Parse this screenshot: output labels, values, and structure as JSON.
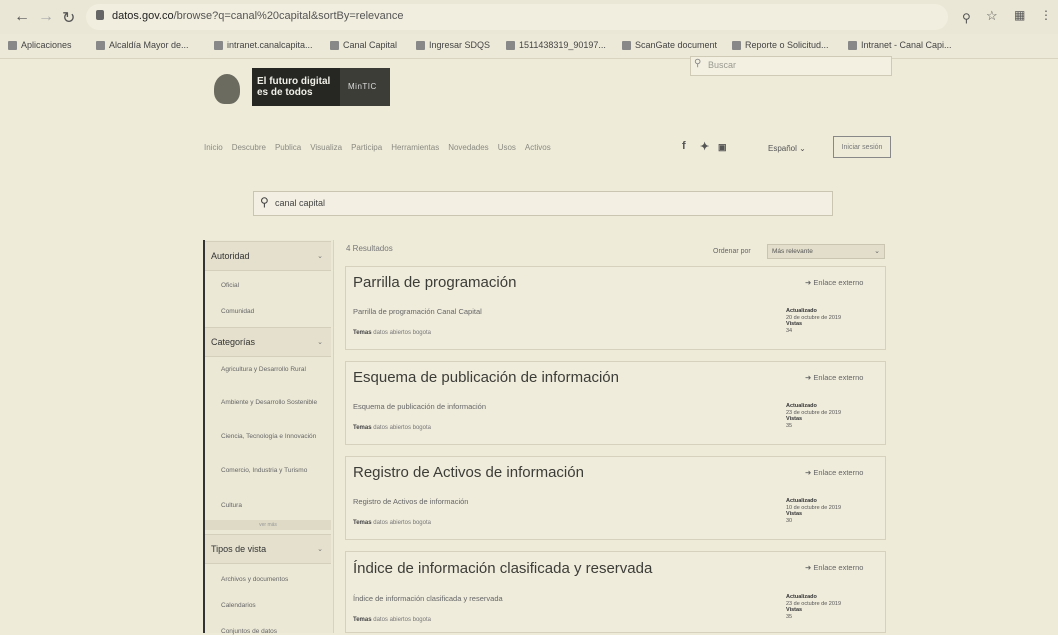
{
  "browser": {
    "url_host": "datos.gov.co",
    "url_path": "/browse?q=canal%20capital&sortBy=relevance",
    "bookmarks": [
      "Aplicaciones",
      "Alcaldía Mayor de...",
      "intranet.canalcapita...",
      "Canal Capital",
      "Ingresar SDQS",
      "1511438319_90197...",
      "ScanGate document",
      "Reporte o Solicitud...",
      "Intranet - Canal Capi..."
    ]
  },
  "header": {
    "logo_line1": "El futuro digital",
    "logo_line2": "es de todos",
    "logo_brand": "MinTIC",
    "search_placeholder": "Buscar",
    "nav": [
      "Inicio",
      "Descubre",
      "Publica",
      "Visualiza",
      "Participa",
      "Herramientas",
      "Novedades",
      "Usos",
      "Activos"
    ],
    "language": "Español",
    "login": "Iniciar sesión"
  },
  "search": {
    "query": "canal capital"
  },
  "sidebar": {
    "sections": [
      {
        "title": "Autoridad",
        "items": [
          "Oficial",
          "Comunidad"
        ]
      },
      {
        "title": "Categorías",
        "items": [
          "Agricultura y Desarrollo Rural",
          "Ambiente y Desarrollo Sostenible",
          "Ciencia, Tecnología e Innovación",
          "Comercio, Industria y Turismo",
          "Cultura"
        ],
        "more": "ver más"
      },
      {
        "title": "Tipos de vista",
        "items": [
          "Archivos y documentos",
          "Calendarios",
          "Conjuntos de datos"
        ]
      }
    ]
  },
  "results": {
    "count": "4 Resultados",
    "sort_label": "Ordenar por",
    "sort_value": "Más relevante",
    "cards": [
      {
        "title": "Parrilla de programación",
        "desc": "Parrilla de programación Canal Capital",
        "tags_label": "Temas",
        "tags": "datos abiertos bogota",
        "link": "Enlace externo",
        "updated_label": "Actualizado",
        "updated": "20 de octubre de 2019",
        "views_label": "Vistas",
        "views": "34"
      },
      {
        "title": "Esquema de publicación de información",
        "desc": "Esquema de publicación de información",
        "tags_label": "Temas",
        "tags": "datos abiertos bogota",
        "link": "Enlace externo",
        "updated_label": "Actualizado",
        "updated": "23 de octubre de 2019",
        "views_label": "Vistas",
        "views": "35"
      },
      {
        "title": "Registro de Activos de información",
        "desc": "Registro de Activos de información",
        "tags_label": "Temas",
        "tags": "datos abiertos bogota",
        "link": "Enlace externo",
        "updated_label": "Actualizado",
        "updated": "10 de octubre de 2019",
        "views_label": "Vistas",
        "views": "30"
      },
      {
        "title": "Índice de información clasificada y reservada",
        "desc": "Índice de información clasificada y reservada",
        "tags_label": "Temas",
        "tags": "datos abiertos bogota",
        "link": "Enlace externo",
        "updated_label": "Actualizado",
        "updated": "23 de octubre de 2019",
        "views_label": "Vistas",
        "views": "35"
      }
    ]
  }
}
